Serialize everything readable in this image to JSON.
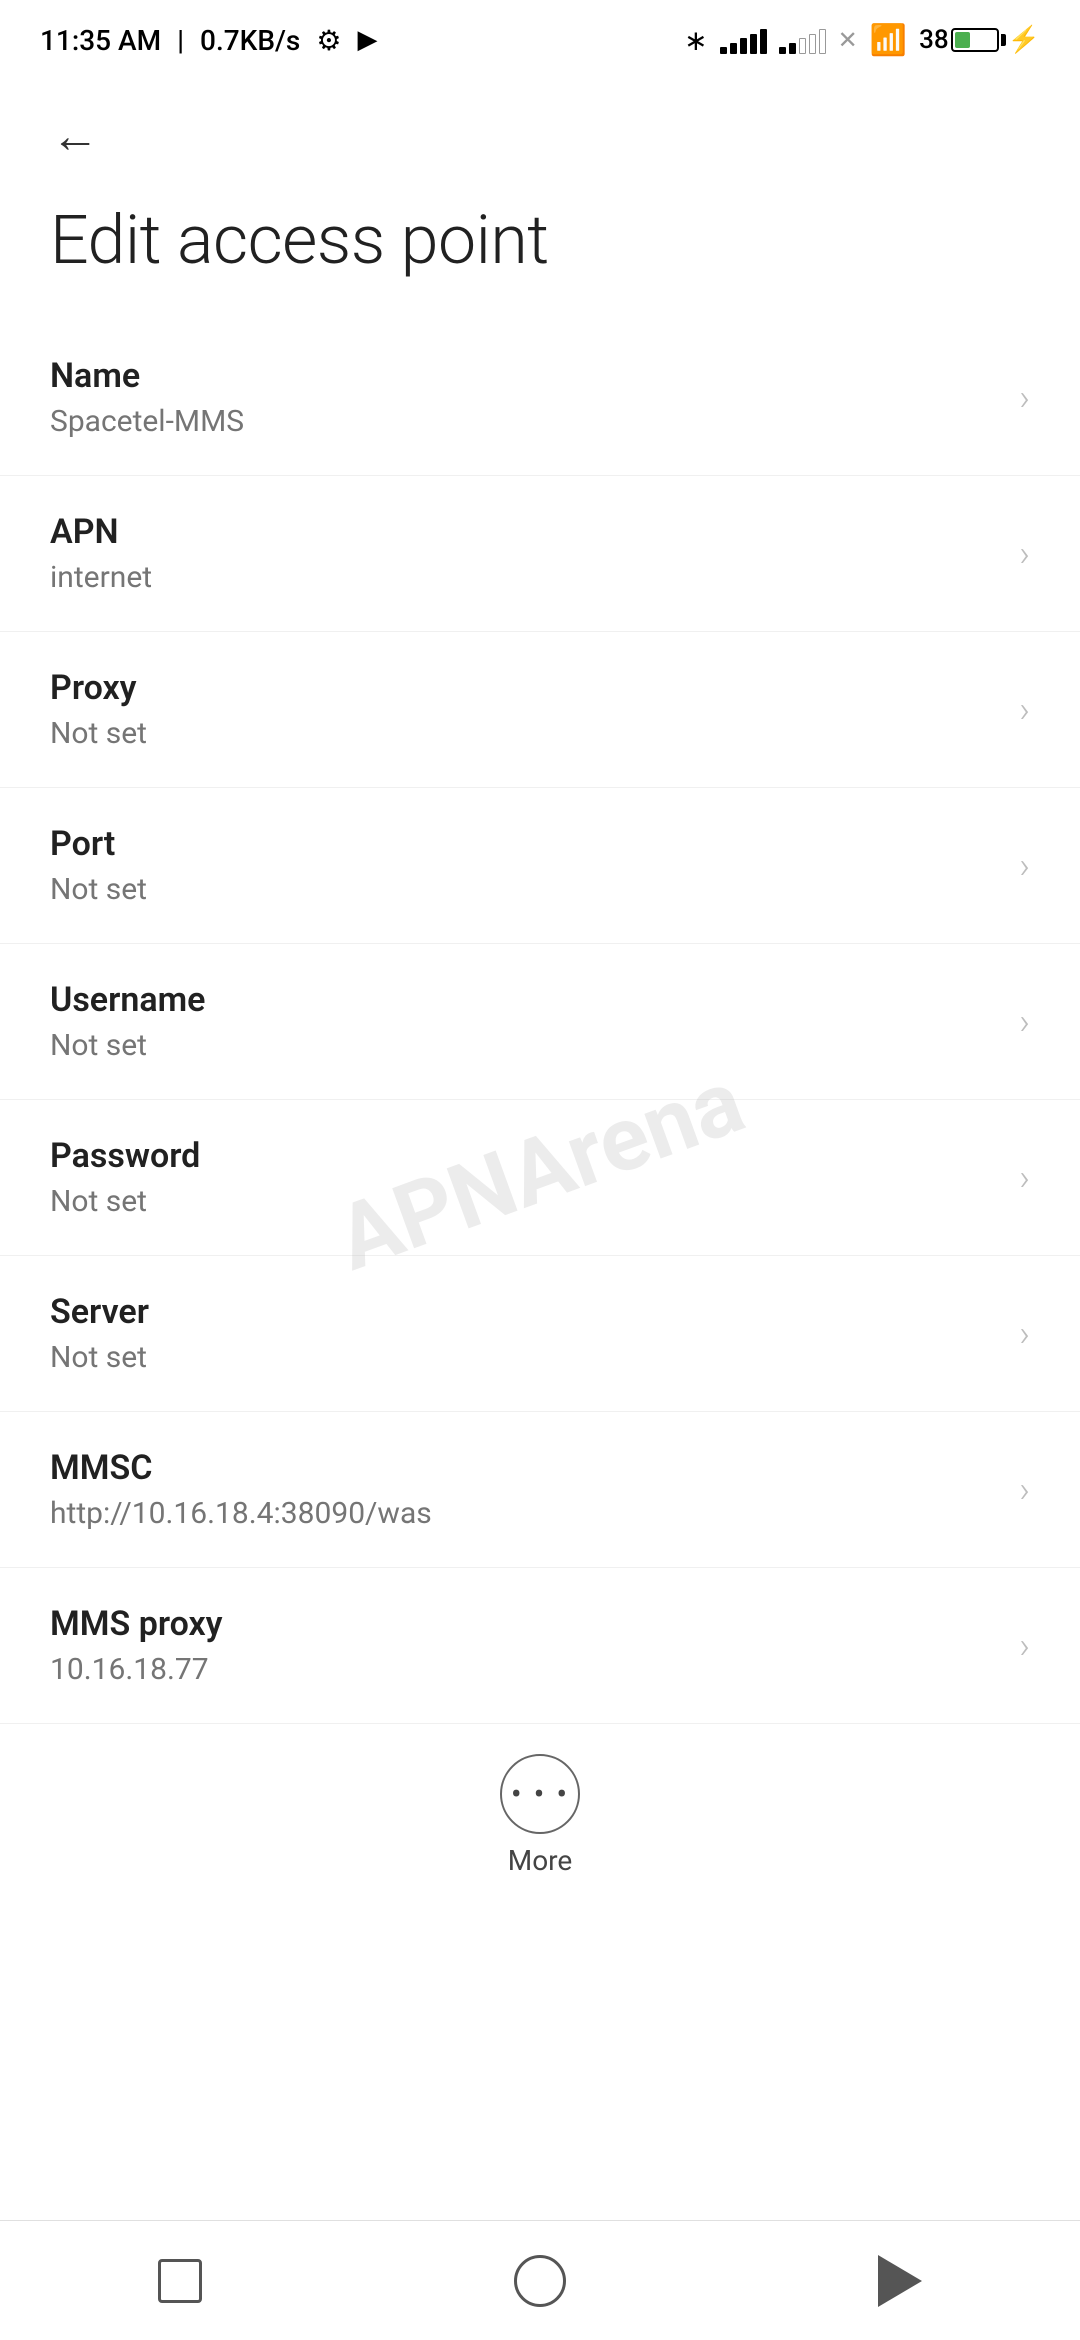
{
  "statusBar": {
    "time": "11:35 AM",
    "speed": "0.7KB/s"
  },
  "nav": {
    "backLabel": "←"
  },
  "page": {
    "title": "Edit access point"
  },
  "settings": [
    {
      "id": "name",
      "label": "Name",
      "value": "Spacetel-MMS"
    },
    {
      "id": "apn",
      "label": "APN",
      "value": "internet"
    },
    {
      "id": "proxy",
      "label": "Proxy",
      "value": "Not set"
    },
    {
      "id": "port",
      "label": "Port",
      "value": "Not set"
    },
    {
      "id": "username",
      "label": "Username",
      "value": "Not set"
    },
    {
      "id": "password",
      "label": "Password",
      "value": "Not set"
    },
    {
      "id": "server",
      "label": "Server",
      "value": "Not set"
    },
    {
      "id": "mmsc",
      "label": "MMSC",
      "value": "http://10.16.18.4:38090/was"
    },
    {
      "id": "mms-proxy",
      "label": "MMS proxy",
      "value": "10.16.18.77"
    }
  ],
  "more": {
    "label": "More",
    "icon": "···"
  },
  "bottomNav": {
    "square": "square",
    "circle": "circle",
    "triangle": "back"
  },
  "watermark": "APNArena"
}
